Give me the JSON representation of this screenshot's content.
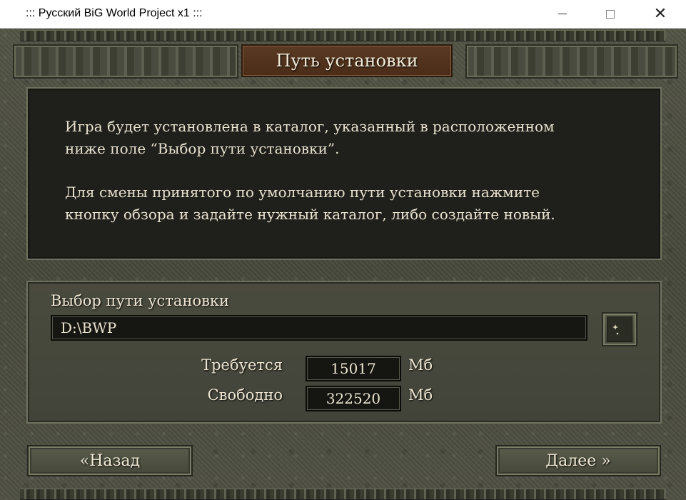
{
  "window": {
    "title": ":::  Русский BiG World Project x1  :::",
    "controls": {
      "minimize": "minimize-icon",
      "maximize": "maximize-icon",
      "close": "close-icon"
    }
  },
  "header": {
    "title": "Путь установки"
  },
  "info": {
    "paragraph1": "Игра будет установлена в каталог, указанный в расположенном\nниже поле “Выбор пути установки”.",
    "paragraph2": "Для смены принятого по умолчанию пути установки нажмите\nкнопку обзора и задайте нужный каталог, либо создайте новый."
  },
  "path": {
    "label": "Выбор пути установки",
    "value": "D:\\BWP",
    "browse_icon": "moon-stars-icon"
  },
  "space": {
    "required_label": "Требуется",
    "required_value": "15017",
    "free_label": "Свободно",
    "free_value": "322520",
    "unit": "Мб"
  },
  "nav": {
    "back": "«Назад",
    "next": "Далее »"
  },
  "colors": {
    "stone": "#4f5043",
    "panel_dark": "#1f201b",
    "header_plate": "#5a3a24",
    "text": "#ece5d2"
  }
}
